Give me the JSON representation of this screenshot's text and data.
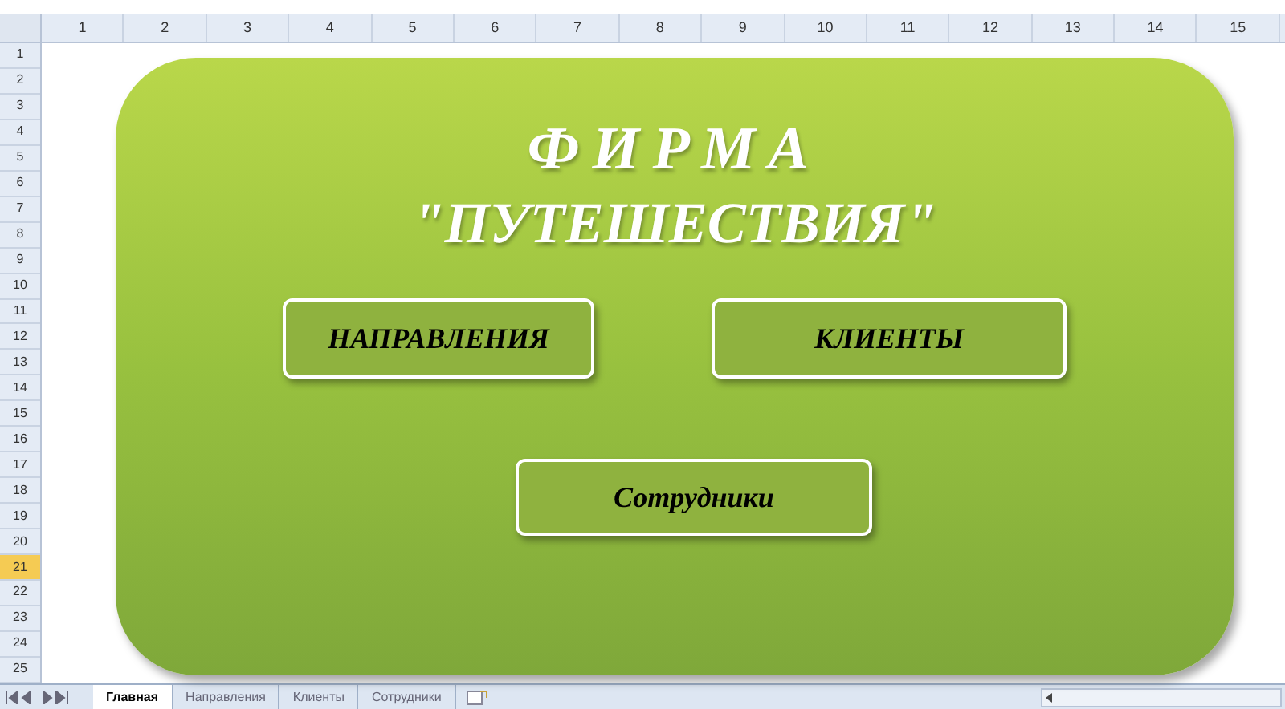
{
  "column_headers": [
    "1",
    "2",
    "3",
    "4",
    "5",
    "6",
    "7",
    "8",
    "9",
    "10",
    "11",
    "12",
    "13",
    "14",
    "15"
  ],
  "row_headers": [
    {
      "label": "1",
      "selected": false
    },
    {
      "label": "2",
      "selected": false
    },
    {
      "label": "3",
      "selected": false
    },
    {
      "label": "4",
      "selected": false
    },
    {
      "label": "5",
      "selected": false
    },
    {
      "label": "6",
      "selected": false
    },
    {
      "label": "7",
      "selected": false
    },
    {
      "label": "8",
      "selected": false
    },
    {
      "label": "9",
      "selected": false
    },
    {
      "label": "10",
      "selected": false
    },
    {
      "label": "11",
      "selected": false
    },
    {
      "label": "12",
      "selected": false
    },
    {
      "label": "13",
      "selected": false
    },
    {
      "label": "14",
      "selected": false
    },
    {
      "label": "15",
      "selected": false
    },
    {
      "label": "16",
      "selected": false
    },
    {
      "label": "17",
      "selected": false
    },
    {
      "label": "18",
      "selected": false
    },
    {
      "label": "19",
      "selected": false
    },
    {
      "label": "20",
      "selected": false
    },
    {
      "label": "21",
      "selected": true
    },
    {
      "label": "22",
      "selected": false
    },
    {
      "label": "23",
      "selected": false
    },
    {
      "label": "24",
      "selected": false
    },
    {
      "label": "25",
      "selected": false
    }
  ],
  "banner": {
    "title_lines": [
      "ФИРМА",
      "\"ПУТЕШЕСТВИЯ\""
    ],
    "buttons": [
      {
        "label": "НАПРАВЛЕНИЯ"
      },
      {
        "label": "КЛИЕНТЫ"
      },
      {
        "label": "Сотрудники"
      }
    ]
  },
  "sheet_tabs": [
    {
      "label": "Главная",
      "selected": true
    },
    {
      "label": "Направления",
      "selected": false
    },
    {
      "label": "Клиенты",
      "selected": false
    },
    {
      "label": "Сотрудники",
      "selected": false
    }
  ]
}
